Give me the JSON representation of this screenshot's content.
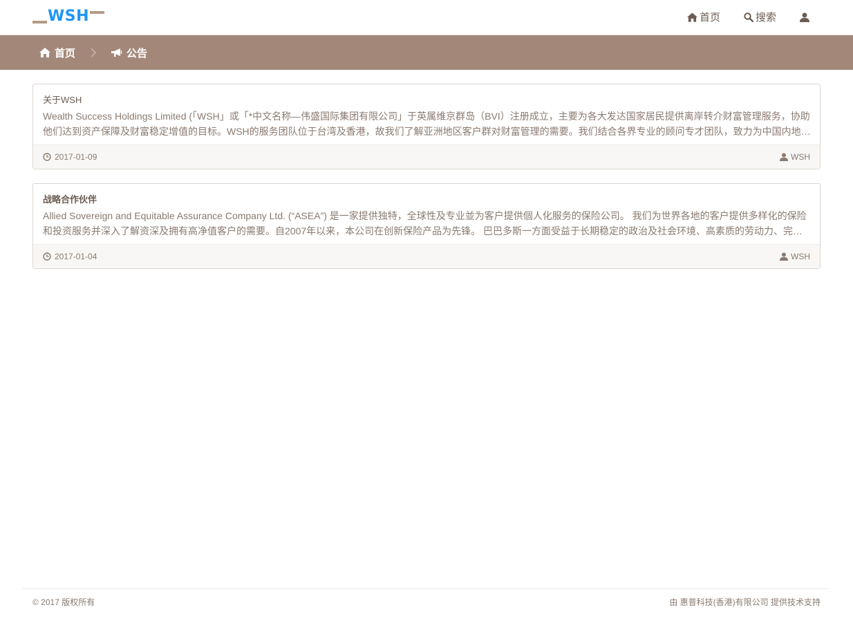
{
  "brand": {
    "logo_text": "WSH",
    "logo_color": "#2196f3",
    "accent_color": "#b59a84"
  },
  "nav": {
    "home_label": "首页",
    "search_label": "搜索"
  },
  "breadcrumb": {
    "home_label": "首页",
    "current_label": "公告",
    "bar_color": "#a3887a"
  },
  "posts": [
    {
      "title": "关于WSH",
      "excerpt": "Wealth Success Holdings Limited (「WSH」或「*中文名称—伟盛国际集团有限公司」于英属维京群岛（BVI）注册成立，主要为各大发达国家居民提供离岸转介财富管理服务，协助他们达到资产保障及财富稳定增值的目标。WSH的服务团队位于台湾及香港，故我们了解亚洲地区客户群对财富管理的需要。我们结合各界专业的顾问专才团队，致力为中国内地及亚洲地区客户提供全面的财富管理服务。",
      "date": "2017-01-09",
      "author": "WSH"
    },
    {
      "title": "战略合作伙伴",
      "excerpt": "Allied Sovereign and Equitable Assurance Company Ltd. (“ASEA”) 是一家提供独特，全球性及专业並为客户提供個人化服务的保险公司。 我们为世界各地的客户提供多样化的保险和投资服务并深入了解资深及拥有高净值客户的需要。自2007年以来，本公司在创新保险产品为先锋。 巴巴多斯一方面受益于长期稳定的政治及社会环境、高素质的劳动力、完善的金融监管体系。",
      "date": "2017-01-04",
      "author": "WSH"
    }
  ],
  "footer": {
    "copyright": "© 2017 版权所有",
    "support": "由 惠普科技(香港)有限公司 提供技术支持"
  }
}
